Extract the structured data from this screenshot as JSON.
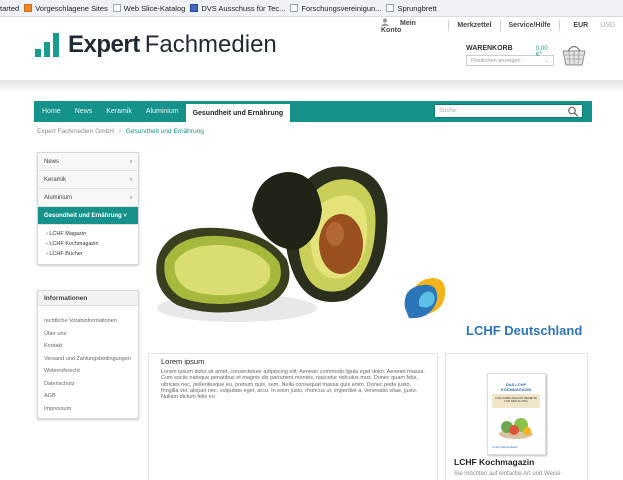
{
  "browser": {
    "bookmarks": [
      {
        "label": "tarted",
        "icon": "none"
      },
      {
        "label": "Vorgeschlagene Sites",
        "icon": "bookmark-orange-icon"
      },
      {
        "label": "Web Slice-Katalog",
        "icon": "page-icon"
      },
      {
        "label": "DVS Ausschuss für Tec...",
        "icon": "dvs-logo-icon"
      },
      {
        "label": "Forschungsvereinigun...",
        "icon": "page-icon"
      },
      {
        "label": "Sprungbrett",
        "icon": "page-icon"
      }
    ]
  },
  "header": {
    "account": "Mein Konto",
    "wishlist": "Merkzettel",
    "service": "Service/Hilfe",
    "currency_active": "EUR",
    "currency_inactive": "USD",
    "logo_word1": "Expert",
    "logo_word2": "Fachmedien",
    "cart_label": "WARENKORB",
    "cart_amount": "0,00 €*",
    "cart_select": "Positionen anzeigen"
  },
  "nav": {
    "items": [
      "Home",
      "News",
      "Keramik",
      "Aluminium",
      "Gesundheit und Ernährung"
    ],
    "active_index": 4,
    "search_placeholder": "Suche:"
  },
  "breadcrumb": {
    "root": "Expert Fachmedien GmbH",
    "separator": "›",
    "current": "Gesundheit und Ernährung"
  },
  "sidebar": {
    "categories": [
      {
        "label": "News",
        "arrow": "›"
      },
      {
        "label": "Keramik",
        "arrow": "›"
      },
      {
        "label": "Aluminium",
        "arrow": "›"
      },
      {
        "label": "Gesundheit und Ernährung",
        "arrow": "˅"
      }
    ],
    "subitems": [
      "› LCHF Magazin",
      "› LCHF Kochmagazin",
      "› LCHF Bücher"
    ]
  },
  "info": {
    "title": "Informationen",
    "links": [
      "rechtliche Vorabinformationen",
      "Über uns",
      "Kontakt",
      "Versand und Zahlungsbedingungen",
      "Widerrufsrecht",
      "Datenschutz",
      "AGB",
      "Impressum"
    ]
  },
  "hero": {
    "brand": "LCHF Deutschland"
  },
  "article": {
    "title": "Lorem ipsum",
    "body": "Lorem ipsum dolor sit amet, consectetuer adipiscing elit. Aenean commodo ligula eget dolor. Aenean massa. Cum sociis natoque penatibus et magnis dis parturient montes, nascetur ridiculus mus. Donec quam felis, ultricies nec, pellentesque eu, pretium quis, sem. Nulla consequat massa quis enim. Donec pede justo, fringilla vel, aliquet nec, vulputate eget, arcu. In enim justo, rhoncus ut, imperdiet a, venenatis vitae, justo. Nullam dictum felis eu"
  },
  "product": {
    "cover_title": "DAS LCHF KOCHMAGAZIN",
    "cover_subtitle": "LOW CARB HIGH FAT REZEPTE FÜR DEN ALLTAG",
    "cover_footer": "LCHF Deutschland",
    "title": "LCHF Kochmagazin",
    "description": "Sie möchten auf einfache Art und Weise"
  },
  "colors": {
    "teal": "#15928a",
    "logo_teal": "#1a9b8f",
    "brand_blue": "#2d75b9"
  }
}
